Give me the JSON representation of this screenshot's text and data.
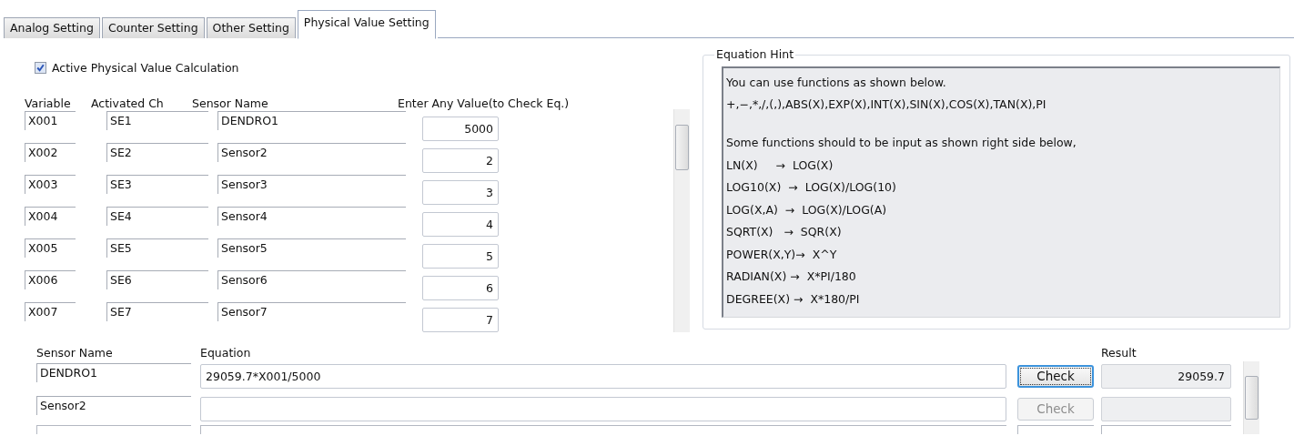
{
  "tabs": [
    {
      "label": "Analog Setting",
      "selected": false
    },
    {
      "label": "Counter Setting",
      "selected": false
    },
    {
      "label": "Other Setting",
      "selected": false
    },
    {
      "label": "Physical Value Setting",
      "selected": true
    }
  ],
  "active_calculation": {
    "label": "Active Physical Value Calculation",
    "checked": true
  },
  "variables": {
    "columns": [
      "Variable",
      "Activated Ch",
      "Sensor Name",
      "Enter Any Value(to Check Eq.)"
    ],
    "rows": [
      {
        "variable": "X001",
        "channel": "SE1",
        "sensor_name": "DENDRO1",
        "value": "5000"
      },
      {
        "variable": "X002",
        "channel": "SE2",
        "sensor_name": "Sensor2",
        "value": "2"
      },
      {
        "variable": "X003",
        "channel": "SE3",
        "sensor_name": "Sensor3",
        "value": "3"
      },
      {
        "variable": "X004",
        "channel": "SE4",
        "sensor_name": "Sensor4",
        "value": "4"
      },
      {
        "variable": "X005",
        "channel": "SE5",
        "sensor_name": "Sensor5",
        "value": "5"
      },
      {
        "variable": "X006",
        "channel": "SE6",
        "sensor_name": "Sensor6",
        "value": "6"
      },
      {
        "variable": "X007",
        "channel": "SE7",
        "sensor_name": "Sensor7",
        "value": "7"
      }
    ]
  },
  "equation_hint": {
    "title": "Equation Hint",
    "paragraphs": [
      [
        "You can use functions as shown below.",
        "+,−,*,/,(,),ABS(X),EXP(X),INT(X),SIN(X),COS(X),TAN(X),PI"
      ],
      [
        "Some functions should to be input as shown right side below,",
        "LN(X)     →  LOG(X)",
        "LOG10(X)  →  LOG(X)/LOG(10)",
        "LOG(X,A)  →  LOG(X)/LOG(A)",
        "SQRT(X)   →  SQR(X)",
        "POWER(X,Y)→  X^Y",
        "RADIAN(X) →  X*PI/180",
        "DEGREE(X) →  X*180/PI"
      ]
    ]
  },
  "equations": {
    "columns": [
      "Sensor Name",
      "Equation",
      "Result"
    ],
    "rows": [
      {
        "sensor_name": "DENDRO1",
        "equation": "29059.7*X001/5000",
        "check": "Check",
        "focused": true,
        "disabled": false,
        "result": "29059.7"
      },
      {
        "sensor_name": "Sensor2",
        "check": "Check",
        "focused": false,
        "disabled": true
      }
    ]
  }
}
